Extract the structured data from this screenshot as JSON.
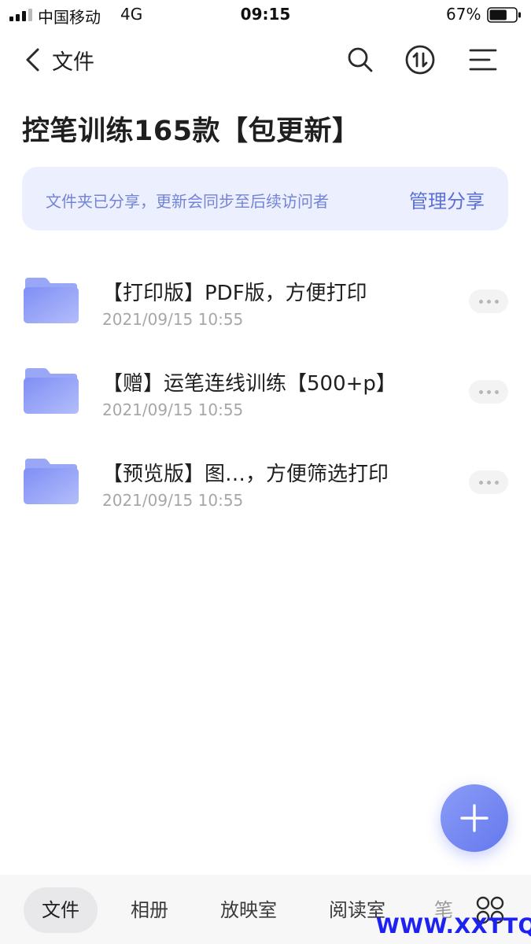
{
  "status_bar": {
    "carrier": "中国移动",
    "network": "4G",
    "time": "09:15",
    "battery_percent": "67%",
    "battery_level": 0.67
  },
  "nav": {
    "back_label": "文件",
    "icons": [
      "search-icon",
      "sort-icon",
      "menu-icon"
    ]
  },
  "page": {
    "title": "控笔训练165款【包更新】"
  },
  "share_banner": {
    "text": "文件夹已分享，更新会同步至后续访问者",
    "action": "管理分享"
  },
  "files": [
    {
      "name": "【打印版】PDF版，方便打印",
      "date": "2021/09/15 10:55"
    },
    {
      "name": "【赠】运笔连线训练【500+p】",
      "date": "2021/09/15 10:55"
    },
    {
      "name": "【预览版】图…，方便筛选打印",
      "date": "2021/09/15 10:55"
    }
  ],
  "tabs": [
    {
      "label": "文件",
      "active": true
    },
    {
      "label": "相册",
      "active": false
    },
    {
      "label": "放映室",
      "active": false
    },
    {
      "label": "阅读室",
      "active": false
    },
    {
      "label": "笔",
      "active": false
    }
  ],
  "watermark": "WWW.XXTTQ.COM",
  "colors": {
    "accent": "#6478ee",
    "banner_bg": "#eceffd",
    "banner_text": "#7484d6",
    "folder": "#8696f6"
  }
}
